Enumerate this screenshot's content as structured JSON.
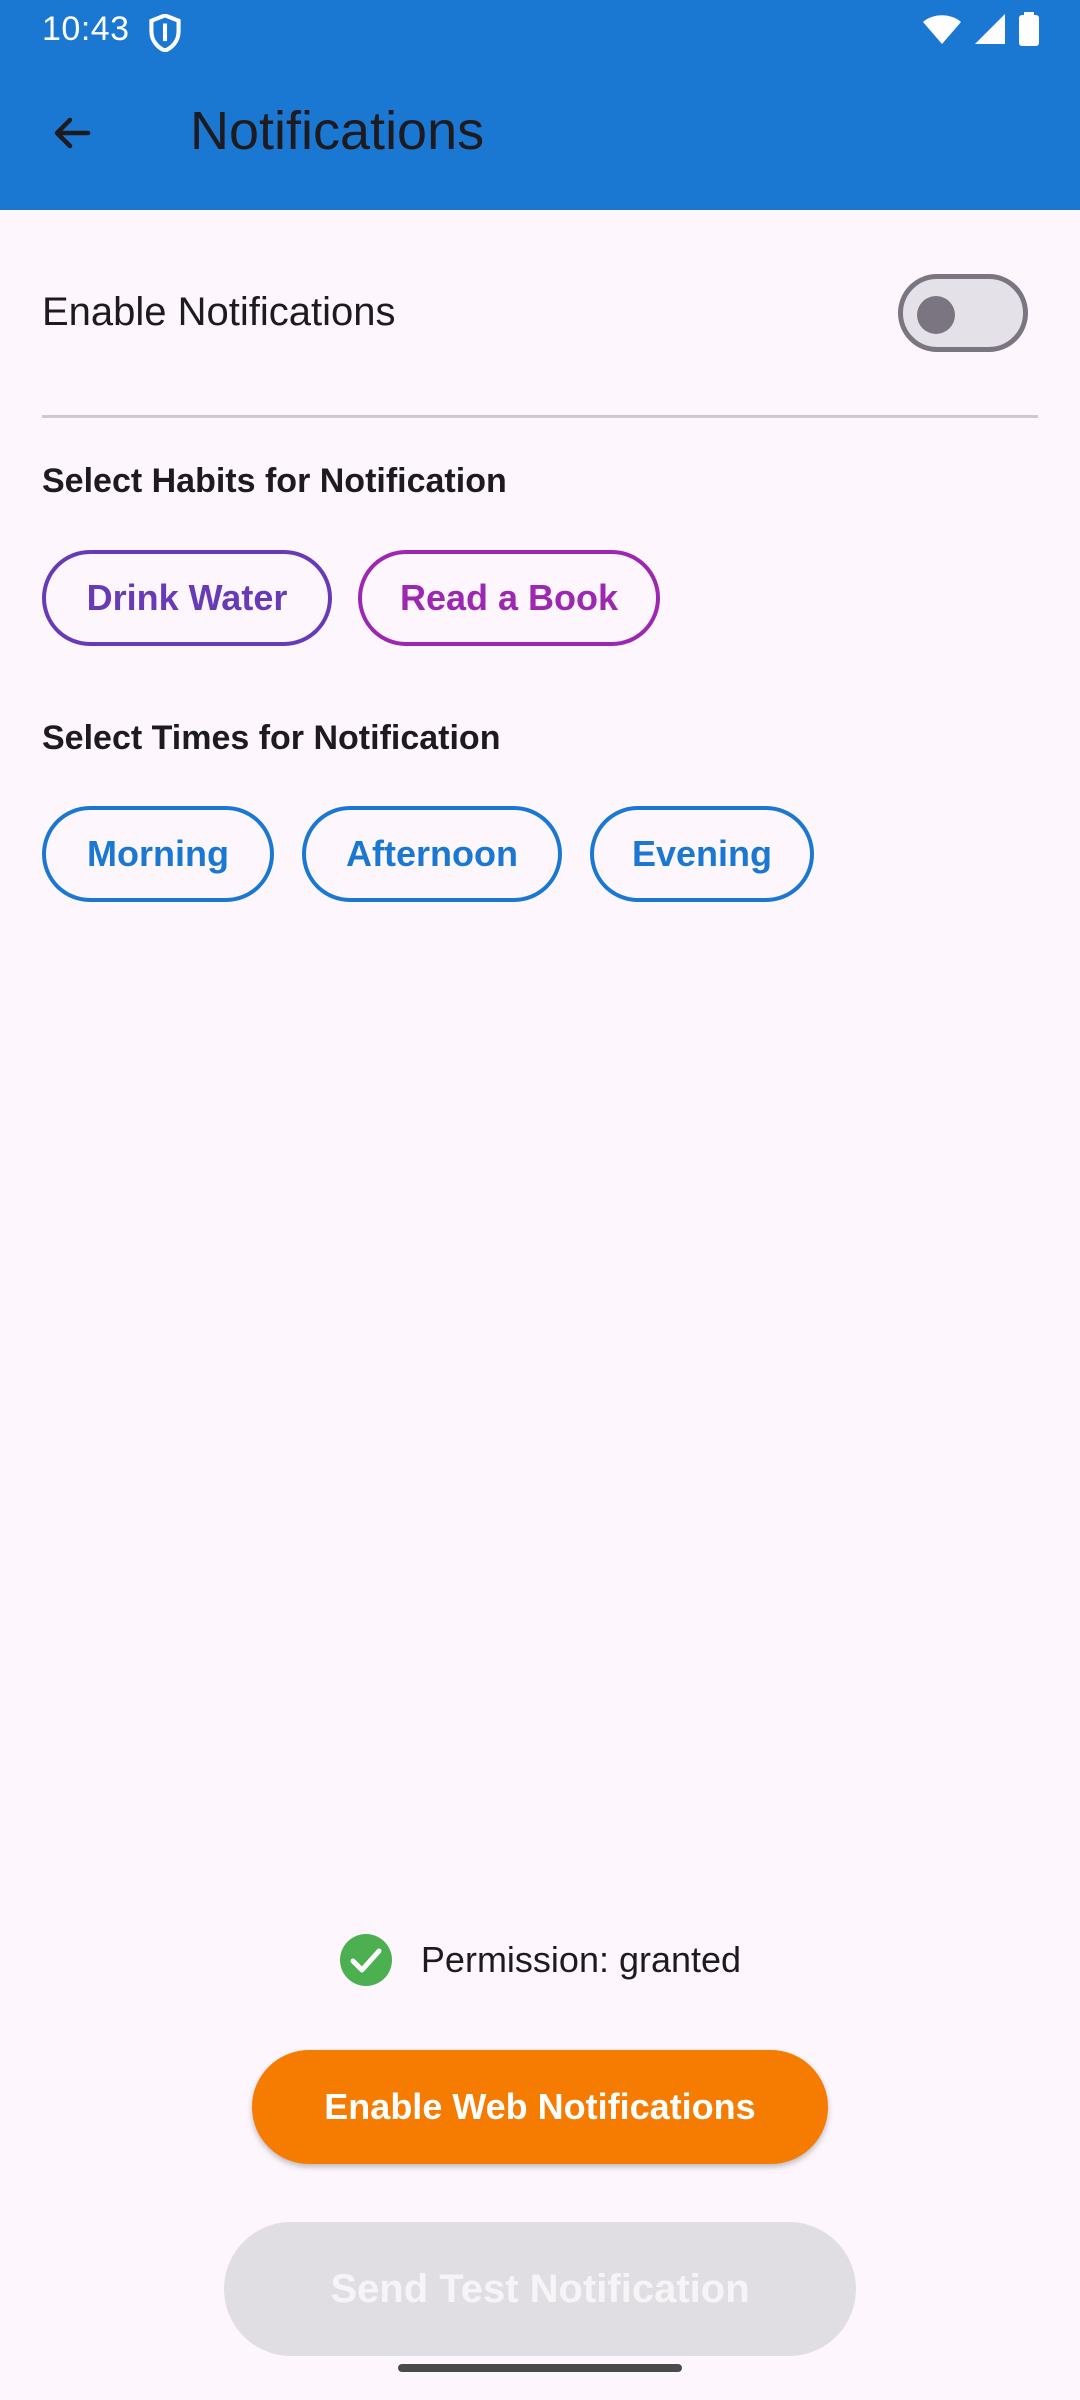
{
  "status_bar": {
    "time": "10:43",
    "icons": [
      "shield-icon",
      "wifi-icon",
      "signal-icon",
      "battery-icon"
    ]
  },
  "app_bar": {
    "title": "Notifications",
    "back_icon": "arrow-back-icon",
    "background_color": "#1b78d2"
  },
  "enable_notifications": {
    "label": "Enable Notifications",
    "enabled": false
  },
  "habits_section": {
    "heading": "Select Habits for Notification",
    "chips": [
      {
        "label": "Drink Water",
        "color": "#673ab7"
      },
      {
        "label": "Read a Book",
        "color": "#9c27b0"
      }
    ]
  },
  "times_section": {
    "heading": "Select Times for Notification",
    "chips": [
      {
        "label": "Morning"
      },
      {
        "label": "Afternoon"
      },
      {
        "label": "Evening"
      }
    ],
    "color": "#1b78d2"
  },
  "permission": {
    "text": "Permission: granted",
    "icon": "check-circle-icon",
    "icon_color": "#4caf50"
  },
  "buttons": {
    "web_notifications": "Enable Web Notifications",
    "web_notifications_color": "#f57c00",
    "test_notification": "Send Test Notification",
    "test_notification_enabled": false
  }
}
